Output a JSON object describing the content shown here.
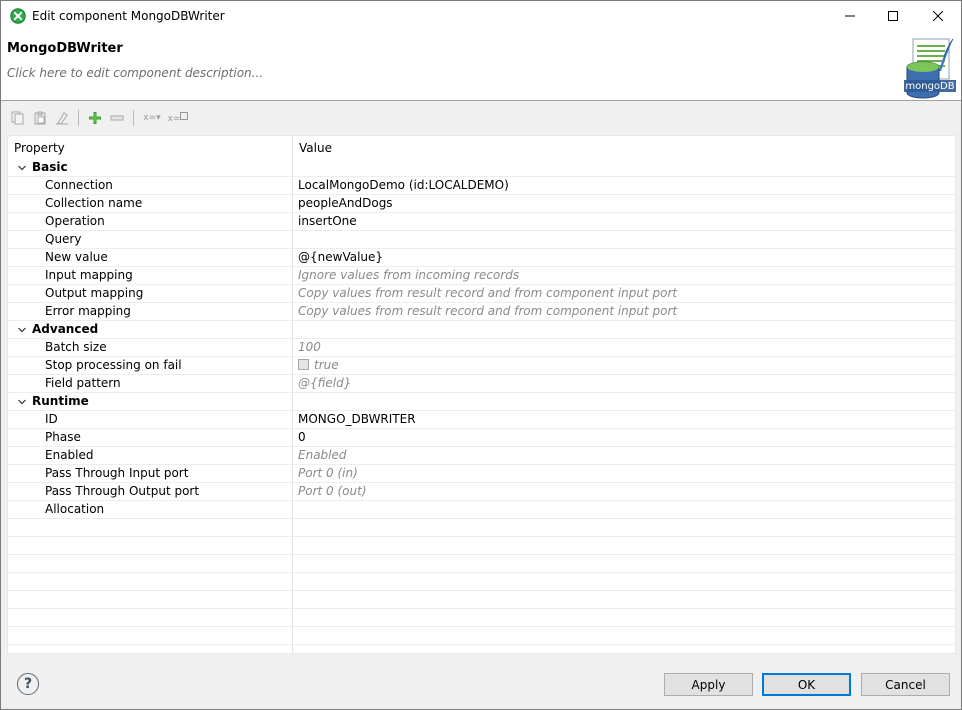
{
  "window": {
    "title": "Edit component MongoDBWriter",
    "icon": "green-circle-x-icon",
    "controls": [
      "minimize",
      "maximize",
      "close"
    ]
  },
  "header": {
    "component_name": "MongoDBWriter",
    "description_placeholder": "Click here to edit component description...",
    "logo_text": "mongoDB",
    "logo_icon": "mongodb-writer-icon"
  },
  "toolbar": {
    "items": [
      "copy-icon",
      "paste-icon",
      "clear-icon",
      "add-icon",
      "remove-icon",
      "set-default-icon",
      "export-icon"
    ],
    "set_label": "x=▾",
    "export_label": "x="
  },
  "table": {
    "col_property": "Property",
    "col_value": "Value",
    "groups": [
      {
        "label": "Basic",
        "rows": [
          {
            "name": "Connection",
            "value": "LocalMongoDemo (id:LOCALDEMO)",
            "style": "normal"
          },
          {
            "name": "Collection name",
            "value": "peopleAndDogs",
            "style": "normal"
          },
          {
            "name": "Operation",
            "value": "insertOne",
            "style": "normal"
          },
          {
            "name": "Query",
            "value": "",
            "style": "normal"
          },
          {
            "name": "New value",
            "value": "@{newValue}",
            "style": "normal"
          },
          {
            "name": "Input mapping",
            "value": "Ignore values from incoming records",
            "style": "default"
          },
          {
            "name": "Output mapping",
            "value": "Copy values from result record and from component input port",
            "style": "default"
          },
          {
            "name": "Error mapping",
            "value": "Copy values from result record and from component input port",
            "style": "default"
          }
        ]
      },
      {
        "label": "Advanced",
        "rows": [
          {
            "name": "Batch size",
            "value": "100",
            "style": "default"
          },
          {
            "name": "Stop processing on fail",
            "value": "true",
            "style": "default",
            "checkbox": true
          },
          {
            "name": "Field pattern",
            "value": "@{field}",
            "style": "default"
          }
        ]
      },
      {
        "label": "Runtime",
        "rows": [
          {
            "name": "ID",
            "value": "MONGO_DBWRITER",
            "style": "normal"
          },
          {
            "name": "Phase",
            "value": "0",
            "style": "normal"
          },
          {
            "name": "Enabled",
            "value": "Enabled",
            "style": "default"
          },
          {
            "name": "Pass Through Input port",
            "value": "Port 0 (in)",
            "style": "default"
          },
          {
            "name": "Pass Through Output port",
            "value": "Port 0 (out)",
            "style": "default"
          },
          {
            "name": "Allocation",
            "value": "",
            "style": "normal"
          }
        ]
      }
    ],
    "empty_rows": 8
  },
  "buttons": {
    "help": "?",
    "apply": "Apply",
    "ok": "OK",
    "cancel": "Cancel"
  }
}
